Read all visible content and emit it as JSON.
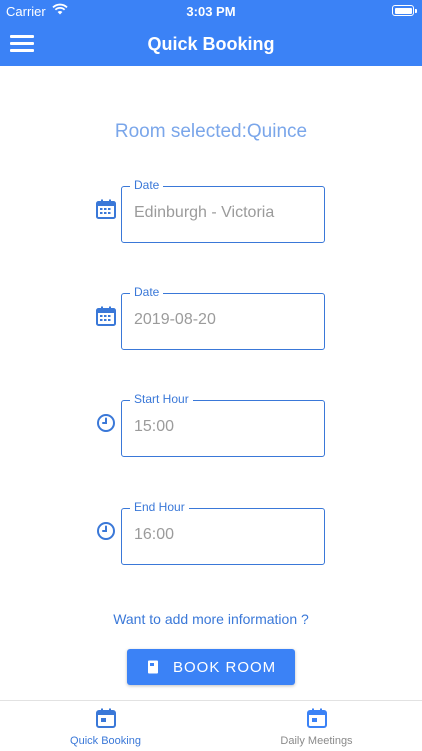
{
  "status_bar": {
    "carrier": "Carrier",
    "time": "3:03 PM"
  },
  "app_bar": {
    "title": "Quick Booking"
  },
  "room_selected": "Room selected:Quince",
  "fields": [
    {
      "label": "Date",
      "value": "Edinburgh - Victoria",
      "icon": "calendar-icon"
    },
    {
      "label": "Date",
      "value": "2019-08-20",
      "icon": "calendar-icon"
    },
    {
      "label": "Start Hour",
      "value": "15:00",
      "icon": "clock-icon"
    },
    {
      "label": "End Hour",
      "value": "16:00",
      "icon": "clock-icon"
    }
  ],
  "more_info_link": "Want to add more information ?",
  "book_button": {
    "label": "BOOK ROOM",
    "icon": "book-icon"
  },
  "tabs": [
    {
      "label": "Quick Booking",
      "icon": "calendar-icon",
      "active": true
    },
    {
      "label": "Daily Meetings",
      "icon": "calendar-icon",
      "active": false
    }
  ],
  "colors": {
    "primary": "#3b82f6",
    "accent_text": "#3a78d8",
    "room_text": "#7aa6ea",
    "placeholder_text": "#9b9b9b",
    "inactive_tab": "#8a8a8a"
  }
}
